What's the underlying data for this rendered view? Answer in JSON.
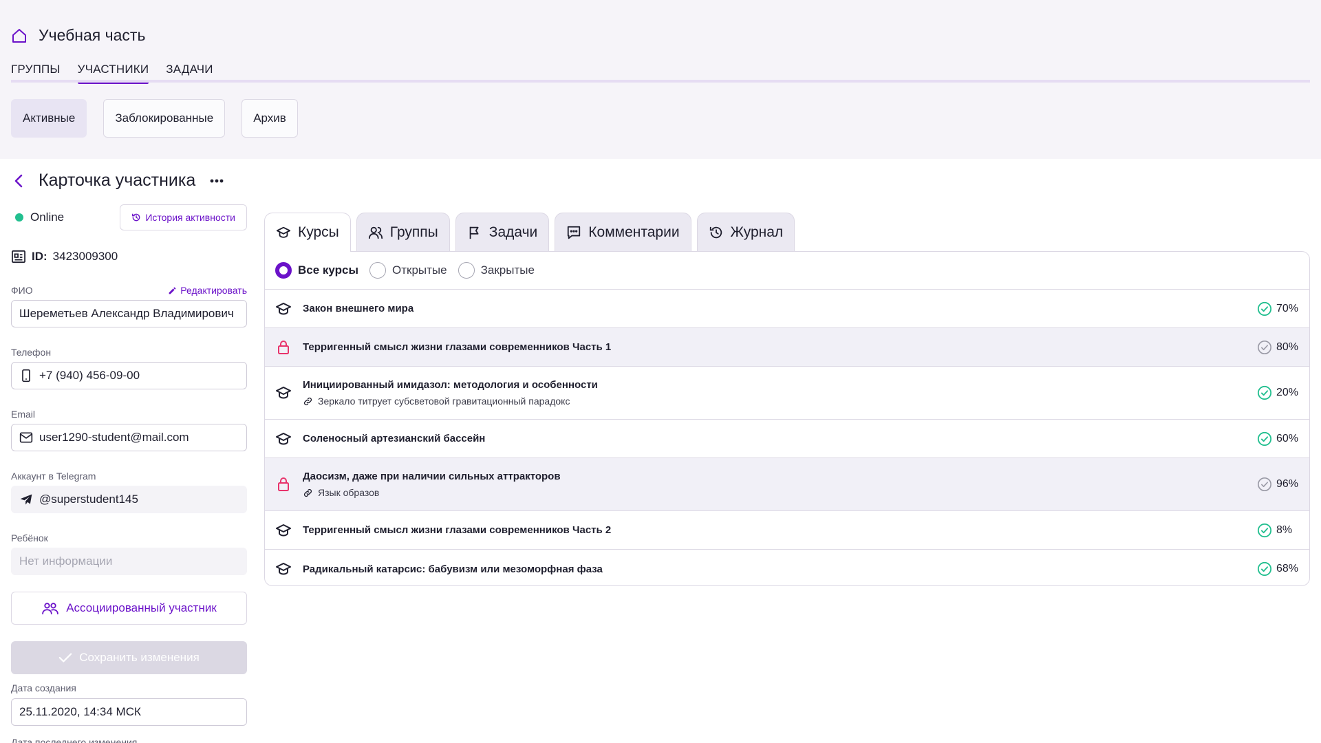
{
  "header": {
    "title": "Учебная часть",
    "nav_tabs": [
      {
        "label": "ГРУППЫ",
        "active": false
      },
      {
        "label": "УЧАСТНИКИ",
        "active": true
      },
      {
        "label": "ЗАДАЧИ",
        "active": false
      }
    ],
    "filters": [
      {
        "label": "Активные",
        "active": true
      },
      {
        "label": "Заблокированные",
        "active": false
      },
      {
        "label": "Архив",
        "active": false
      }
    ]
  },
  "card": {
    "title": "Карточка участника"
  },
  "profile": {
    "status": "Online",
    "history_button": "История активности",
    "id_label": "ID:",
    "id_value": "3423009300",
    "fio_label": "ФИО",
    "edit_label": "Редактировать",
    "fio_value": "Шереметьев Александр Владимирович",
    "phone_label": "Телефон",
    "phone_value": "+7 (940) 456-09-00",
    "email_label": "Email",
    "email_value": "user1290-student@mail.com",
    "telegram_label": "Аккаунт в Telegram",
    "telegram_value": "@superstudent145",
    "child_label": "Ребёнок",
    "child_placeholder": "Нет информации",
    "assoc_button": "Ассоциированный участник",
    "save_button": "Сохранить изменения",
    "created_label": "Дата создания",
    "created_value": "25.11.2020, 14:34 МСК",
    "modified_label": "Дата последнего изменения"
  },
  "course_tabs": [
    {
      "label": "Курсы",
      "icon": "graduation-cap-icon",
      "active": true
    },
    {
      "label": "Группы",
      "icon": "users-icon",
      "active": false
    },
    {
      "label": "Задачи",
      "icon": "flag-icon",
      "active": false
    },
    {
      "label": "Комментарии",
      "icon": "comment-icon",
      "active": false
    },
    {
      "label": "Журнал",
      "icon": "history-icon",
      "active": false
    }
  ],
  "course_filter": {
    "options": [
      {
        "label": "Все курсы",
        "selected": true
      },
      {
        "label": "Открытые",
        "selected": false
      },
      {
        "label": "Закрытые",
        "selected": false
      }
    ]
  },
  "courses": [
    {
      "name": "Закон внешнего мира",
      "sub": "",
      "locked": false,
      "progress": "70%",
      "complete": true
    },
    {
      "name": "Терригенный смысл жизни глазами современников Часть 1",
      "sub": "",
      "locked": true,
      "progress": "80%",
      "complete": false
    },
    {
      "name": "Инициированный имидазол: методология и особенности",
      "sub": "Зеркало титрует субсветовой гравитационный парадокс",
      "locked": false,
      "progress": "20%",
      "complete": true
    },
    {
      "name": "Соленосный артезианский бассейн",
      "sub": "",
      "locked": false,
      "progress": "60%",
      "complete": true
    },
    {
      "name": "Даосизм, даже при наличии сильных аттракторов",
      "sub": "Язык образов",
      "locked": true,
      "progress": "96%",
      "complete": false
    },
    {
      "name": "Терригенный смысл жизни глазами современников Часть 2",
      "sub": "",
      "locked": false,
      "progress": "8%",
      "complete": true
    },
    {
      "name": "Радикальный катарсис: бабувизм или мезоморфная фаза",
      "sub": "",
      "locked": false,
      "progress": "68%",
      "complete": true
    }
  ],
  "colors": {
    "accent": "#6b12c9",
    "success": "#22bf8f",
    "lock": "#e8336b",
    "muted_check": "#9a9aa6"
  }
}
